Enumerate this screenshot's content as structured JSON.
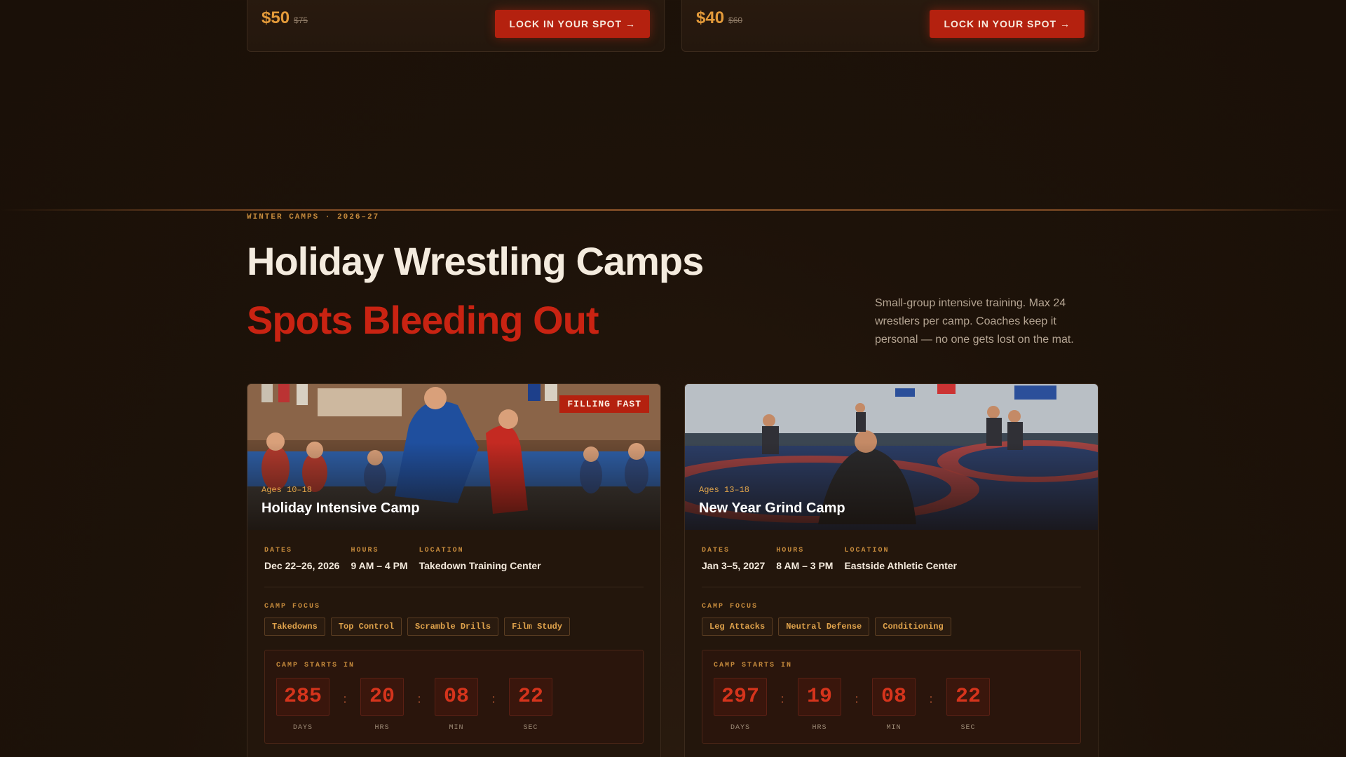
{
  "pricing_cards": [
    {
      "price": "$50",
      "old_price": "$75",
      "cta": "LOCK IN YOUR SPOT →"
    },
    {
      "price": "$40",
      "old_price": "$60",
      "cta": "LOCK IN YOUR SPOT →"
    }
  ],
  "section": {
    "eyebrow": "WINTER CAMPS · 2026–27",
    "headline": "Holiday Wrestling Camps",
    "subheadline": "Spots Bleeding Out",
    "intro": "Small-group intensive training. Max 24 wrestlers per camp. Coaches keep it personal — no one gets lost on the mat."
  },
  "camps": [
    {
      "badge": "FILLING FAST",
      "ages": "Ages 10–18",
      "title": "Holiday Intensive Camp",
      "meta": [
        {
          "label": "DATES",
          "value": "Dec 22–26, 2026"
        },
        {
          "label": "HOURS",
          "value": "9 AM – 4 PM"
        },
        {
          "label": "LOCATION",
          "value": "Takedown Training Center"
        }
      ],
      "focus_label": "CAMP FOCUS",
      "focus": [
        "Takedowns",
        "Top Control",
        "Scramble Drills",
        "Film Study"
      ],
      "countdown_label": "CAMP STARTS IN",
      "countdown": [
        {
          "value": "285",
          "unit": "DAYS"
        },
        {
          "value": "20",
          "unit": "HRS"
        },
        {
          "value": "08",
          "unit": "MIN"
        },
        {
          "value": "22",
          "unit": "SEC"
        }
      ]
    },
    {
      "badge": "",
      "ages": "Ages 13–18",
      "title": "New Year Grind Camp",
      "meta": [
        {
          "label": "DATES",
          "value": "Jan 3–5, 2027"
        },
        {
          "label": "HOURS",
          "value": "8 AM – 3 PM"
        },
        {
          "label": "LOCATION",
          "value": "Eastside Athletic Center"
        }
      ],
      "focus_label": "CAMP FOCUS",
      "focus": [
        "Leg Attacks",
        "Neutral Defense",
        "Conditioning"
      ],
      "countdown_label": "CAMP STARTS IN",
      "countdown": [
        {
          "value": "297",
          "unit": "DAYS"
        },
        {
          "value": "19",
          "unit": "HRS"
        },
        {
          "value": "08",
          "unit": "MIN"
        },
        {
          "value": "22",
          "unit": "SEC"
        }
      ]
    }
  ],
  "colors": {
    "accent_red": "#b4210f",
    "headline_red": "#c92312",
    "gold": "#c58a3c",
    "background": "#1e130b"
  }
}
